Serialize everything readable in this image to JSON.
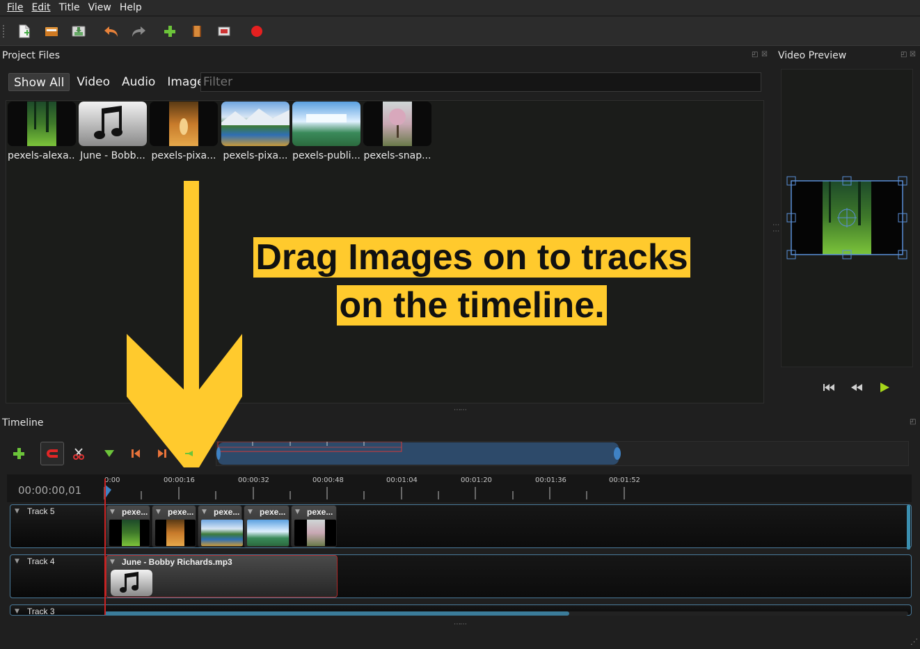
{
  "menu": {
    "file": "File",
    "edit": "Edit",
    "title": "Title",
    "view": "View",
    "help": "Help"
  },
  "toolbar": {
    "icons": [
      "new-project-icon",
      "open-project-icon",
      "save-project-icon",
      "undo-icon",
      "redo-icon",
      "import-files-icon",
      "choose-profile-icon",
      "fullscreen-icon",
      "export-video-icon"
    ]
  },
  "project_files": {
    "title": "Project Files",
    "tabs": {
      "show_all": "Show All",
      "video": "Video",
      "audio": "Audio",
      "image": "Image"
    },
    "filter_placeholder": "Filter",
    "items": [
      {
        "label": "pexels-alexa...",
        "kind": "forest"
      },
      {
        "label": "June - Bobb...",
        "kind": "audio"
      },
      {
        "label": "pexels-pixa...",
        "kind": "autumn"
      },
      {
        "label": "pexels-pixa...",
        "kind": "lake"
      },
      {
        "label": "pexels-publi...",
        "kind": "waterfall"
      },
      {
        "label": "pexels-snap...",
        "kind": "tree"
      }
    ]
  },
  "overlay": {
    "line1": "Drag Images on to tracks",
    "line2": "on the timeline."
  },
  "video_preview": {
    "title": "Video Preview"
  },
  "timeline": {
    "title": "Timeline",
    "time_code": "00:00:00,01",
    "ticks": [
      "0:00",
      "00:00:16",
      "00:00:32",
      "00:00:48",
      "00:01:04",
      "00:01:20",
      "00:01:36",
      "00:01:52"
    ],
    "tracks": {
      "track5": {
        "name": "Track 5",
        "clips": [
          "pexe...",
          "pexe...",
          "pexe...",
          "pexe...",
          "pexe..."
        ]
      },
      "track4": {
        "name": "Track 4",
        "clip": "June - Bobby Richards.mp3"
      },
      "track3": {
        "name": "Track 3"
      }
    }
  },
  "colors": {
    "accent": "#ffca2d",
    "selection": "#3b7c9a",
    "playhead": "#cc2222"
  }
}
